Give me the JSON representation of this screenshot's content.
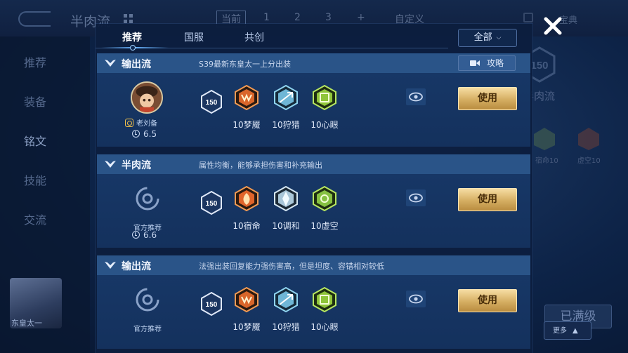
{
  "background": {
    "title": "半肉流",
    "tabs": [
      "当前",
      "1",
      "2",
      "3",
      "+",
      "自定义"
    ],
    "top_right_text": "宝典",
    "sidebar": [
      "推荐",
      "装备",
      "铭文",
      "技能",
      "交流"
    ],
    "hero_name": "东皇太一",
    "right_level": "150",
    "right_title": "半肉流",
    "right_rune_labels": [
      "宿命10",
      "虚空10"
    ],
    "full_level_label": "已满级",
    "more_label": "更多"
  },
  "modal": {
    "tabs": [
      "推荐",
      "国服",
      "共创"
    ],
    "active_tab": "推荐",
    "filter": "全部",
    "close_icon": "close-icon"
  },
  "cards": [
    {
      "name": "输出流",
      "description": "S39最新东皇太一上分出装",
      "has_guide": true,
      "guide_label": "攻略",
      "author": "老刘备",
      "official": false,
      "rating": "6.5",
      "level": "150",
      "runes": [
        {
          "label": "10梦魇",
          "color": "#d9662a"
        },
        {
          "label": "10狩猎",
          "color": "#6fb6d6"
        },
        {
          "label": "10心眼",
          "color": "#8fc53a"
        }
      ],
      "use_label": "使用"
    },
    {
      "name": "半肉流",
      "description": "属性均衡，能够承担伤害和补充输出",
      "has_guide": false,
      "author": "官方推荐",
      "official": true,
      "rating": "6.6",
      "level": "150",
      "runes": [
        {
          "label": "10宿命",
          "color": "#e0642a"
        },
        {
          "label": "10调和",
          "color": "#a9c6d8"
        },
        {
          "label": "10虚空",
          "color": "#86c142"
        }
      ],
      "use_label": "使用"
    },
    {
      "name": "输出流",
      "description": "法强出装回复能力强伤害高，但是坦度、容错相对较低",
      "has_guide": false,
      "author": "官方推荐",
      "official": true,
      "rating": "",
      "level": "150",
      "runes": [
        {
          "label": "10梦魇",
          "color": "#d9662a"
        },
        {
          "label": "10狩猎",
          "color": "#6fb6d6"
        },
        {
          "label": "10心眼",
          "color": "#8fc53a"
        }
      ],
      "use_label": "使用"
    }
  ]
}
